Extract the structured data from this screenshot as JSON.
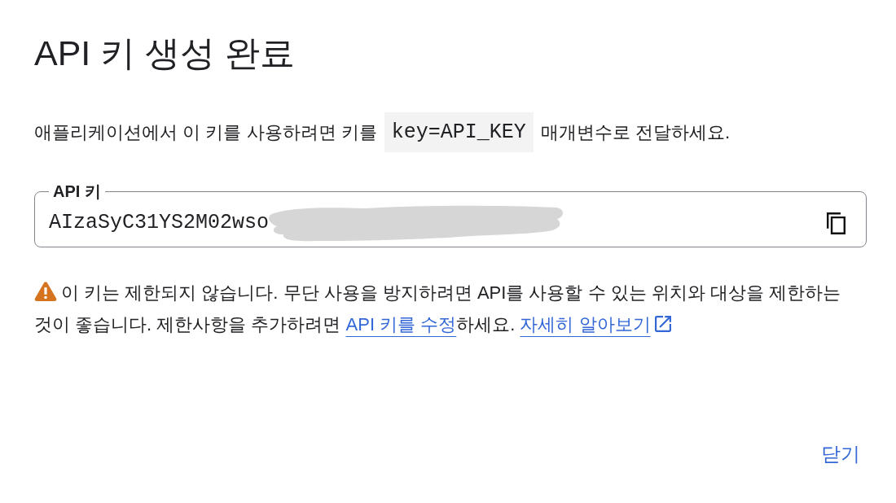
{
  "dialog": {
    "title": "API 키 생성 완료",
    "instruction": {
      "before": "애플리케이션에서 이 키를 사용하려면 키를",
      "code": "key=API_KEY",
      "after": "매개변수로 전달하세요."
    },
    "key_field": {
      "label": "API 키",
      "value": "AIzaSyC31YS2M02wso",
      "redacted": true
    },
    "warning": {
      "parts": [
        {
          "kind": "text",
          "text": "이 키는 제한되지 않습니다. 무단 사용을 방지하려면 API를 사용할 수 있는 위치와 대상을 제한하는 것이 좋습니다. 제한사항을 추가하려면 "
        },
        {
          "kind": "link",
          "text": "API 키를 수정",
          "external": false
        },
        {
          "kind": "text",
          "text": "하세요. "
        },
        {
          "kind": "link",
          "text": "자세히 알아보기",
          "external": true
        }
      ]
    },
    "buttons": [
      {
        "label": "닫기"
      }
    ]
  }
}
